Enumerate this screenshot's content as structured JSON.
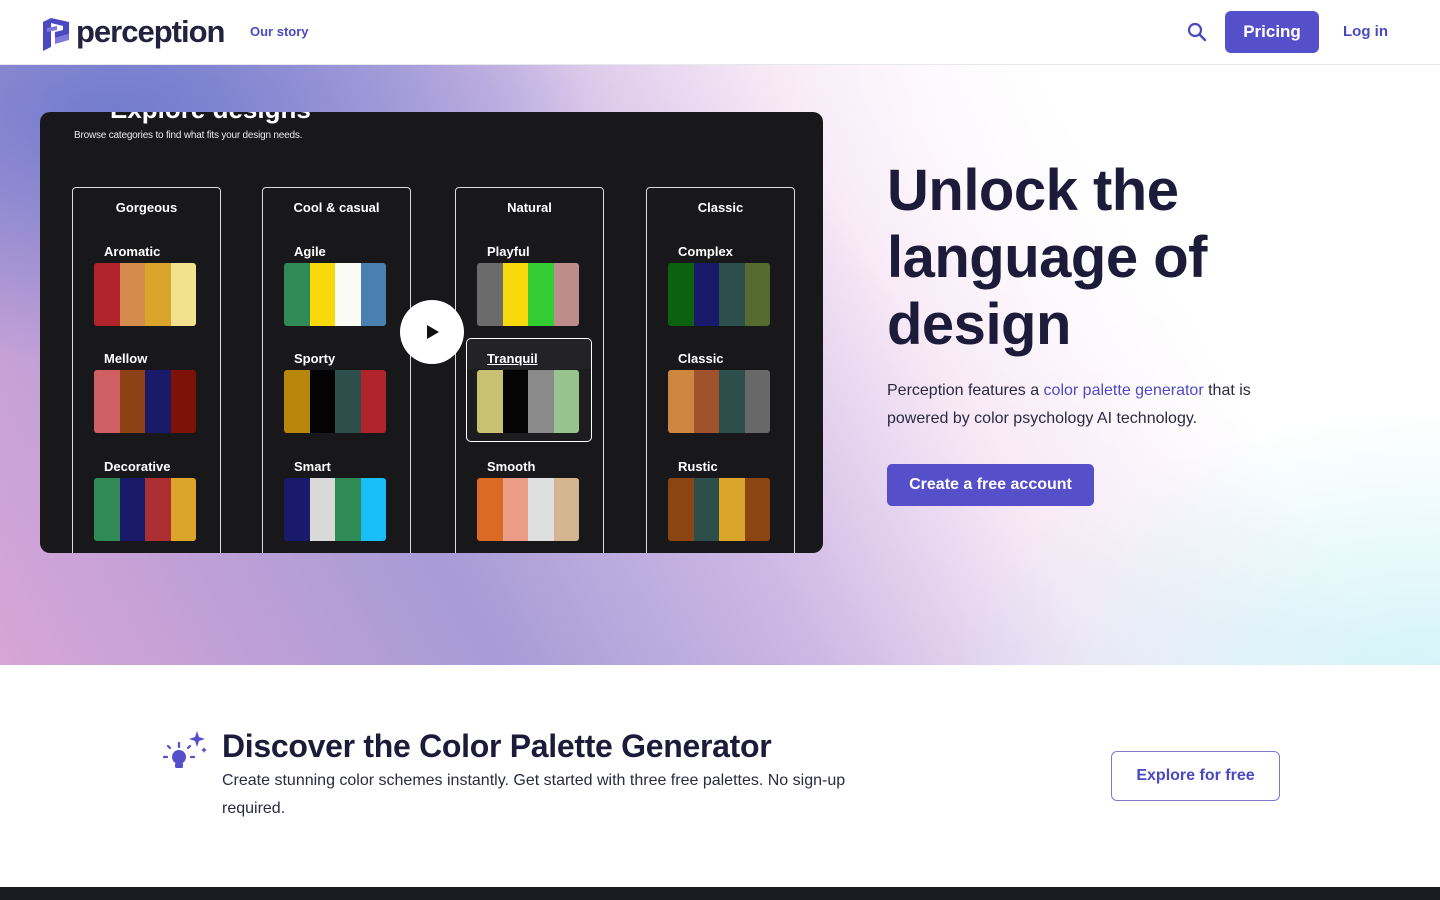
{
  "header": {
    "logo_text": "perception",
    "nav_our_story": "Our story",
    "pricing_label": "Pricing",
    "login_label": "Log in"
  },
  "hero": {
    "video": {
      "subtitle": "Browse categories to find what fits your design needs.",
      "columns": [
        {
          "title": "Gorgeous",
          "groups": [
            {
              "name": "Aromatic",
              "colors": [
                "#b1232d",
                "#d48b4b",
                "#dba52b",
                "#f2e18d"
              ]
            },
            {
              "name": "Mellow",
              "colors": [
                "#cf5f63",
                "#8c4117",
                "#1a1a6a",
                "#7c1207"
              ]
            },
            {
              "name": "Decorative",
              "colors": [
                "#2f8a55",
                "#1a1a6a",
                "#aa2e32",
                "#dba52b"
              ]
            }
          ]
        },
        {
          "title": "Cool & casual",
          "groups": [
            {
              "name": "Agile",
              "colors": [
                "#2f8a55",
                "#f9d80c",
                "#fbfbf5",
                "#4a7fb2"
              ]
            },
            {
              "name": "Sporty",
              "colors": [
                "#b8860b",
                "#030303",
                "#2d4f4c",
                "#b1232d"
              ]
            },
            {
              "name": "Smart",
              "colors": [
                "#1a1a6a",
                "#d9d9d9",
                "#2f8a55",
                "#19bdf7"
              ]
            }
          ]
        },
        {
          "title": "Natural",
          "groups": [
            {
              "name": "Playful",
              "colors": [
                "#6b6b6b",
                "#f9d80c",
                "#33cc33",
                "#bf8c8c"
              ]
            },
            {
              "name": "Tranquil",
              "colors": [
                "#c8c072",
                "#050505",
                "#8a8a8a",
                "#96c38e"
              ]
            },
            {
              "name": "Smooth",
              "colors": [
                "#db6a26",
                "#ec9c84",
                "#dedede",
                "#d3b58f"
              ]
            }
          ]
        },
        {
          "title": "Classic",
          "groups": [
            {
              "name": "Complex",
              "colors": [
                "#0b6110",
                "#1a1a6a",
                "#2d4f4c",
                "#556b2f"
              ]
            },
            {
              "name": "Classic",
              "colors": [
                "#cd853f",
                "#a0522d",
                "#2d4f4c",
                "#686868"
              ]
            },
            {
              "name": "Rustic",
              "colors": [
                "#8b4513",
                "#2d4f4c",
                "#dba52b",
                "#8b4513"
              ]
            }
          ]
        }
      ]
    },
    "title": "Unlock the language of design",
    "text_before": "Perception features a ",
    "text_link": "color palette generator",
    "text_after": " that is powered by color psychology AI technology.",
    "cta_label": "Create a free account"
  },
  "discover": {
    "title": "Discover the Color Palette Generator",
    "text": "Create stunning color schemes instantly. Get started with three free palettes. No sign-up required.",
    "button_label": "Explore for free"
  },
  "colors": {
    "accent": "#5550c9",
    "link": "#4b49c1",
    "heading": "#1c1c3a"
  }
}
